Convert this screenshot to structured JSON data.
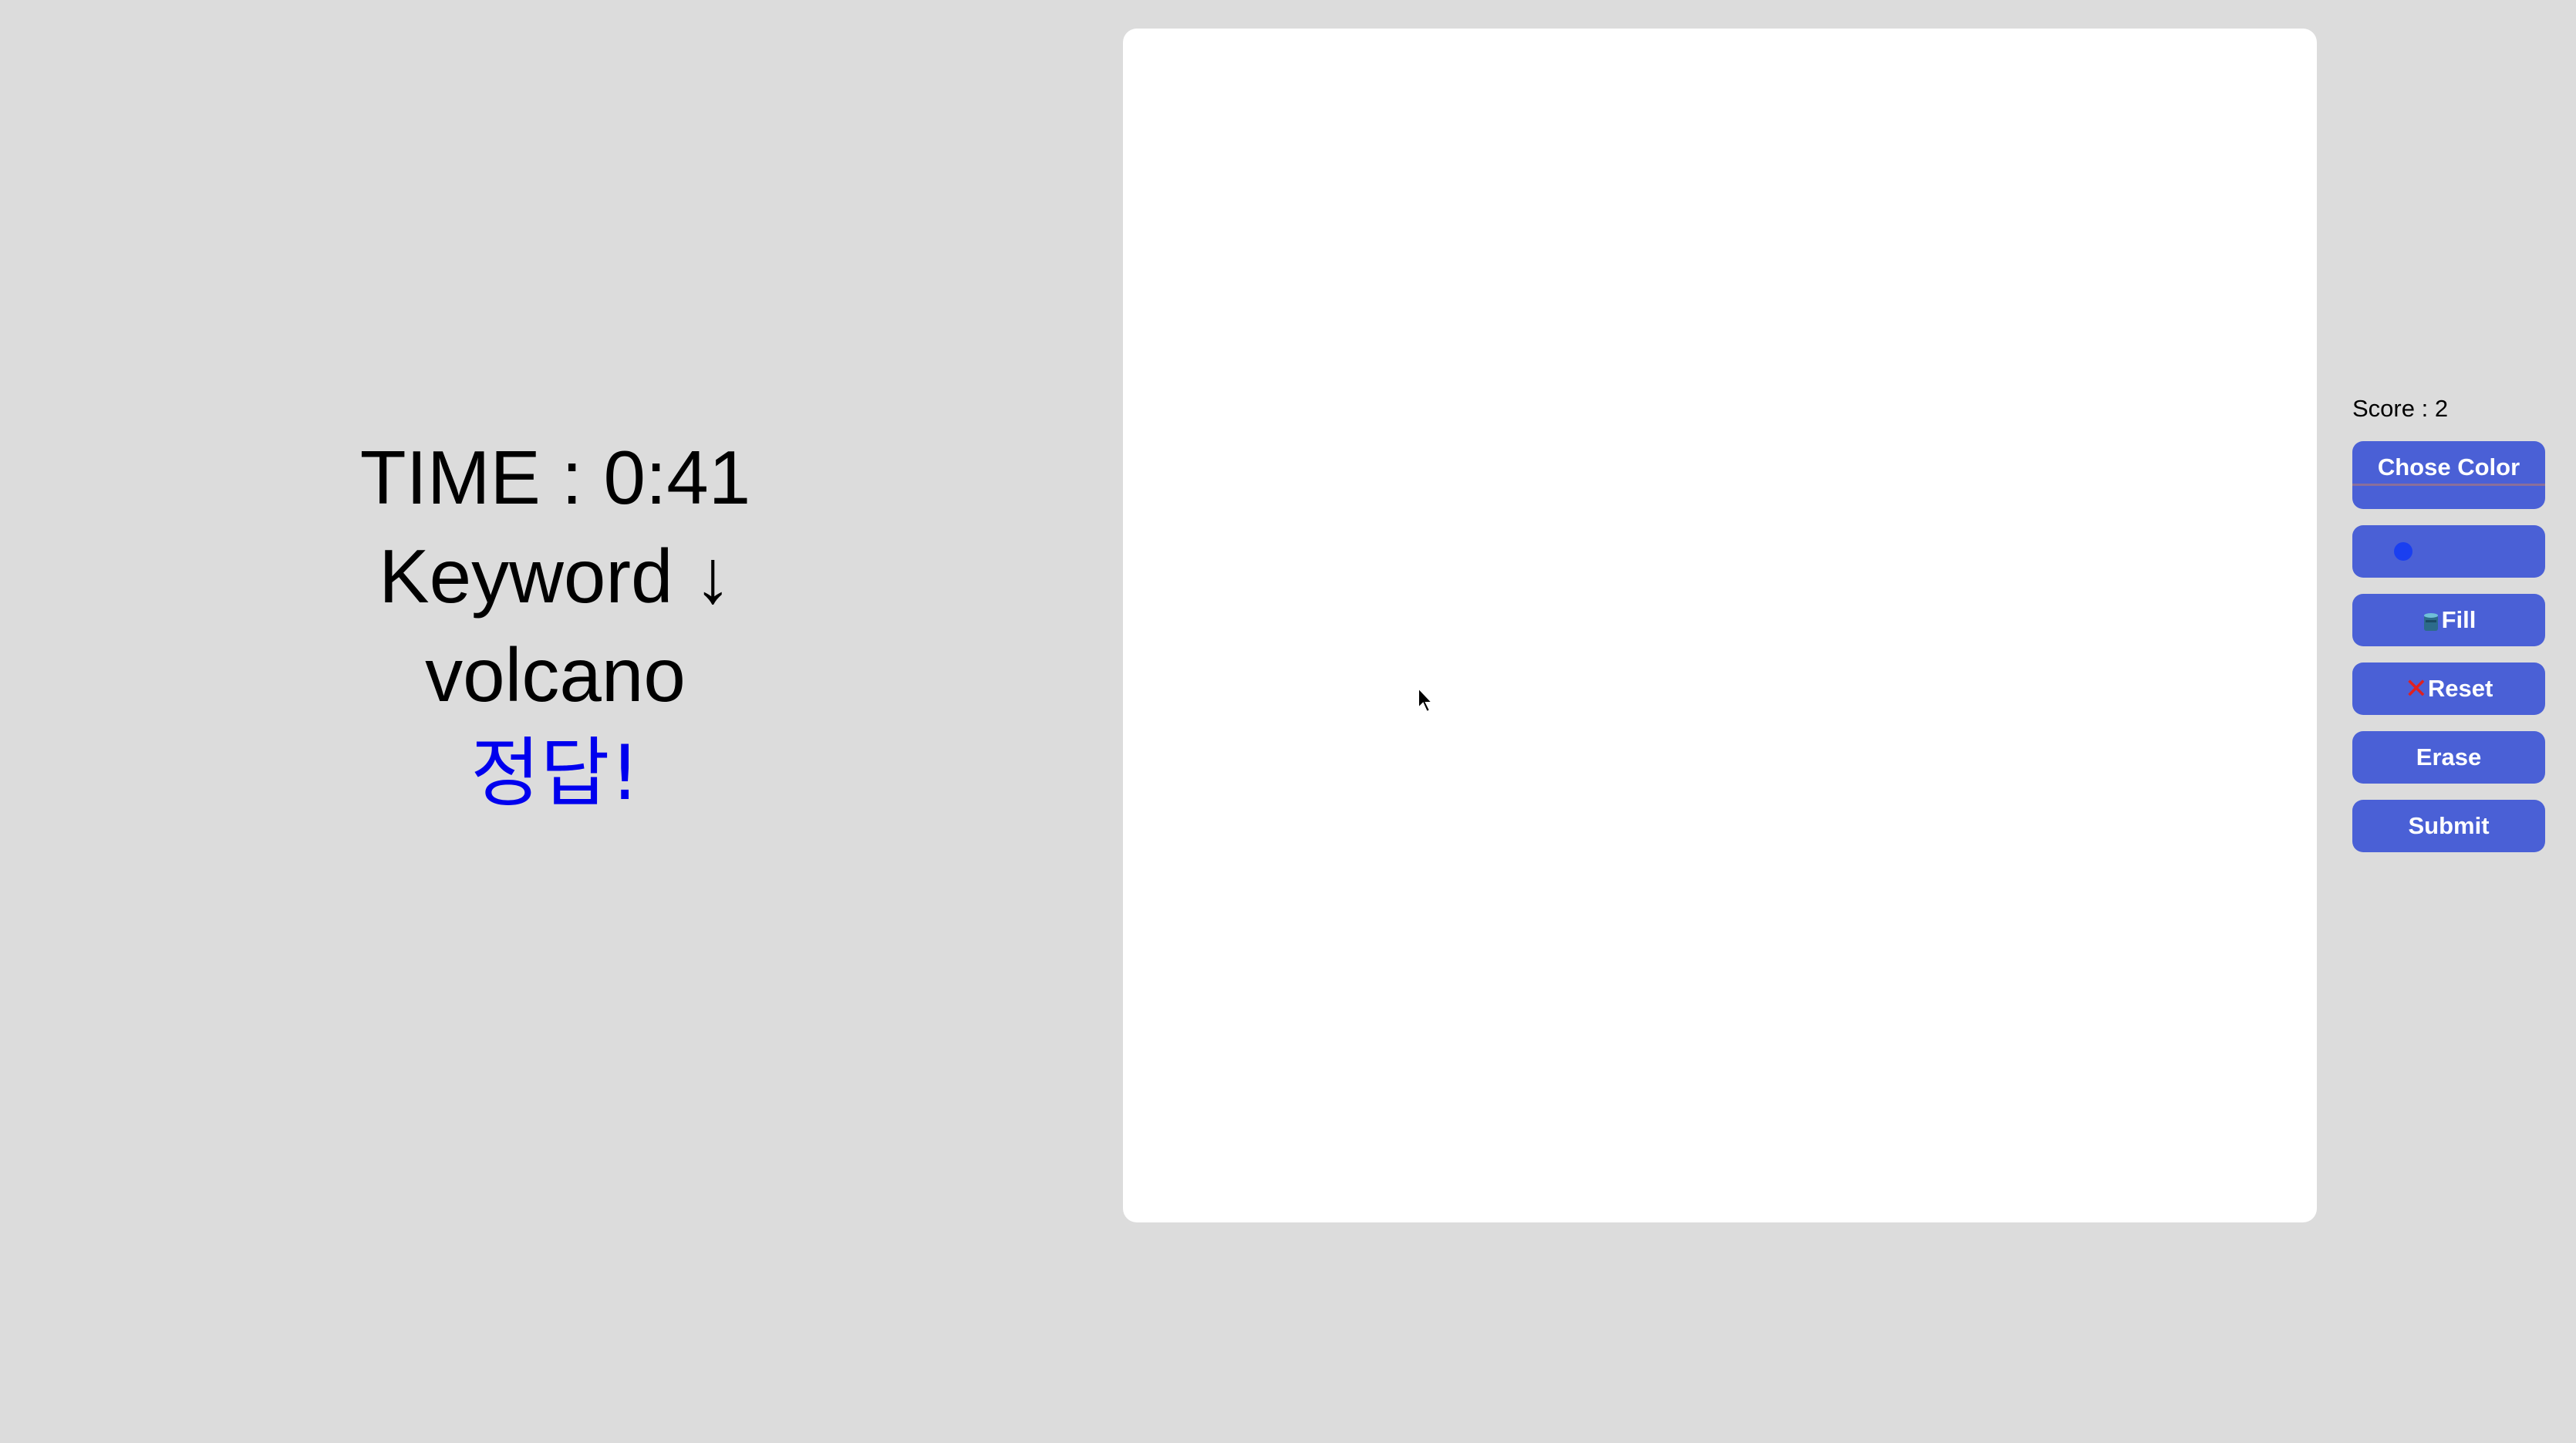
{
  "game": {
    "time_text": "TIME : 0:41",
    "keyword_text": "Keyword ↓",
    "keyword_value": "volcano",
    "answer_feedback": "정답!"
  },
  "sidebar": {
    "score_text": "Score : 2",
    "choose_color_label": "Chose Color",
    "brush_color": "#1a3ff0",
    "fill_label": "Fill",
    "reset_label": "Reset",
    "erase_label": "Erase",
    "submit_label": "Submit"
  },
  "colors": {
    "button_bg": "#4a60d6",
    "answer_text": "#0000ee",
    "page_bg": "#dcdcdc",
    "canvas_bg": "#ffffff"
  },
  "icons": {
    "fill": "paint-bucket-icon",
    "reset": "red-x-icon",
    "brush": "brush-color-dot-icon"
  }
}
